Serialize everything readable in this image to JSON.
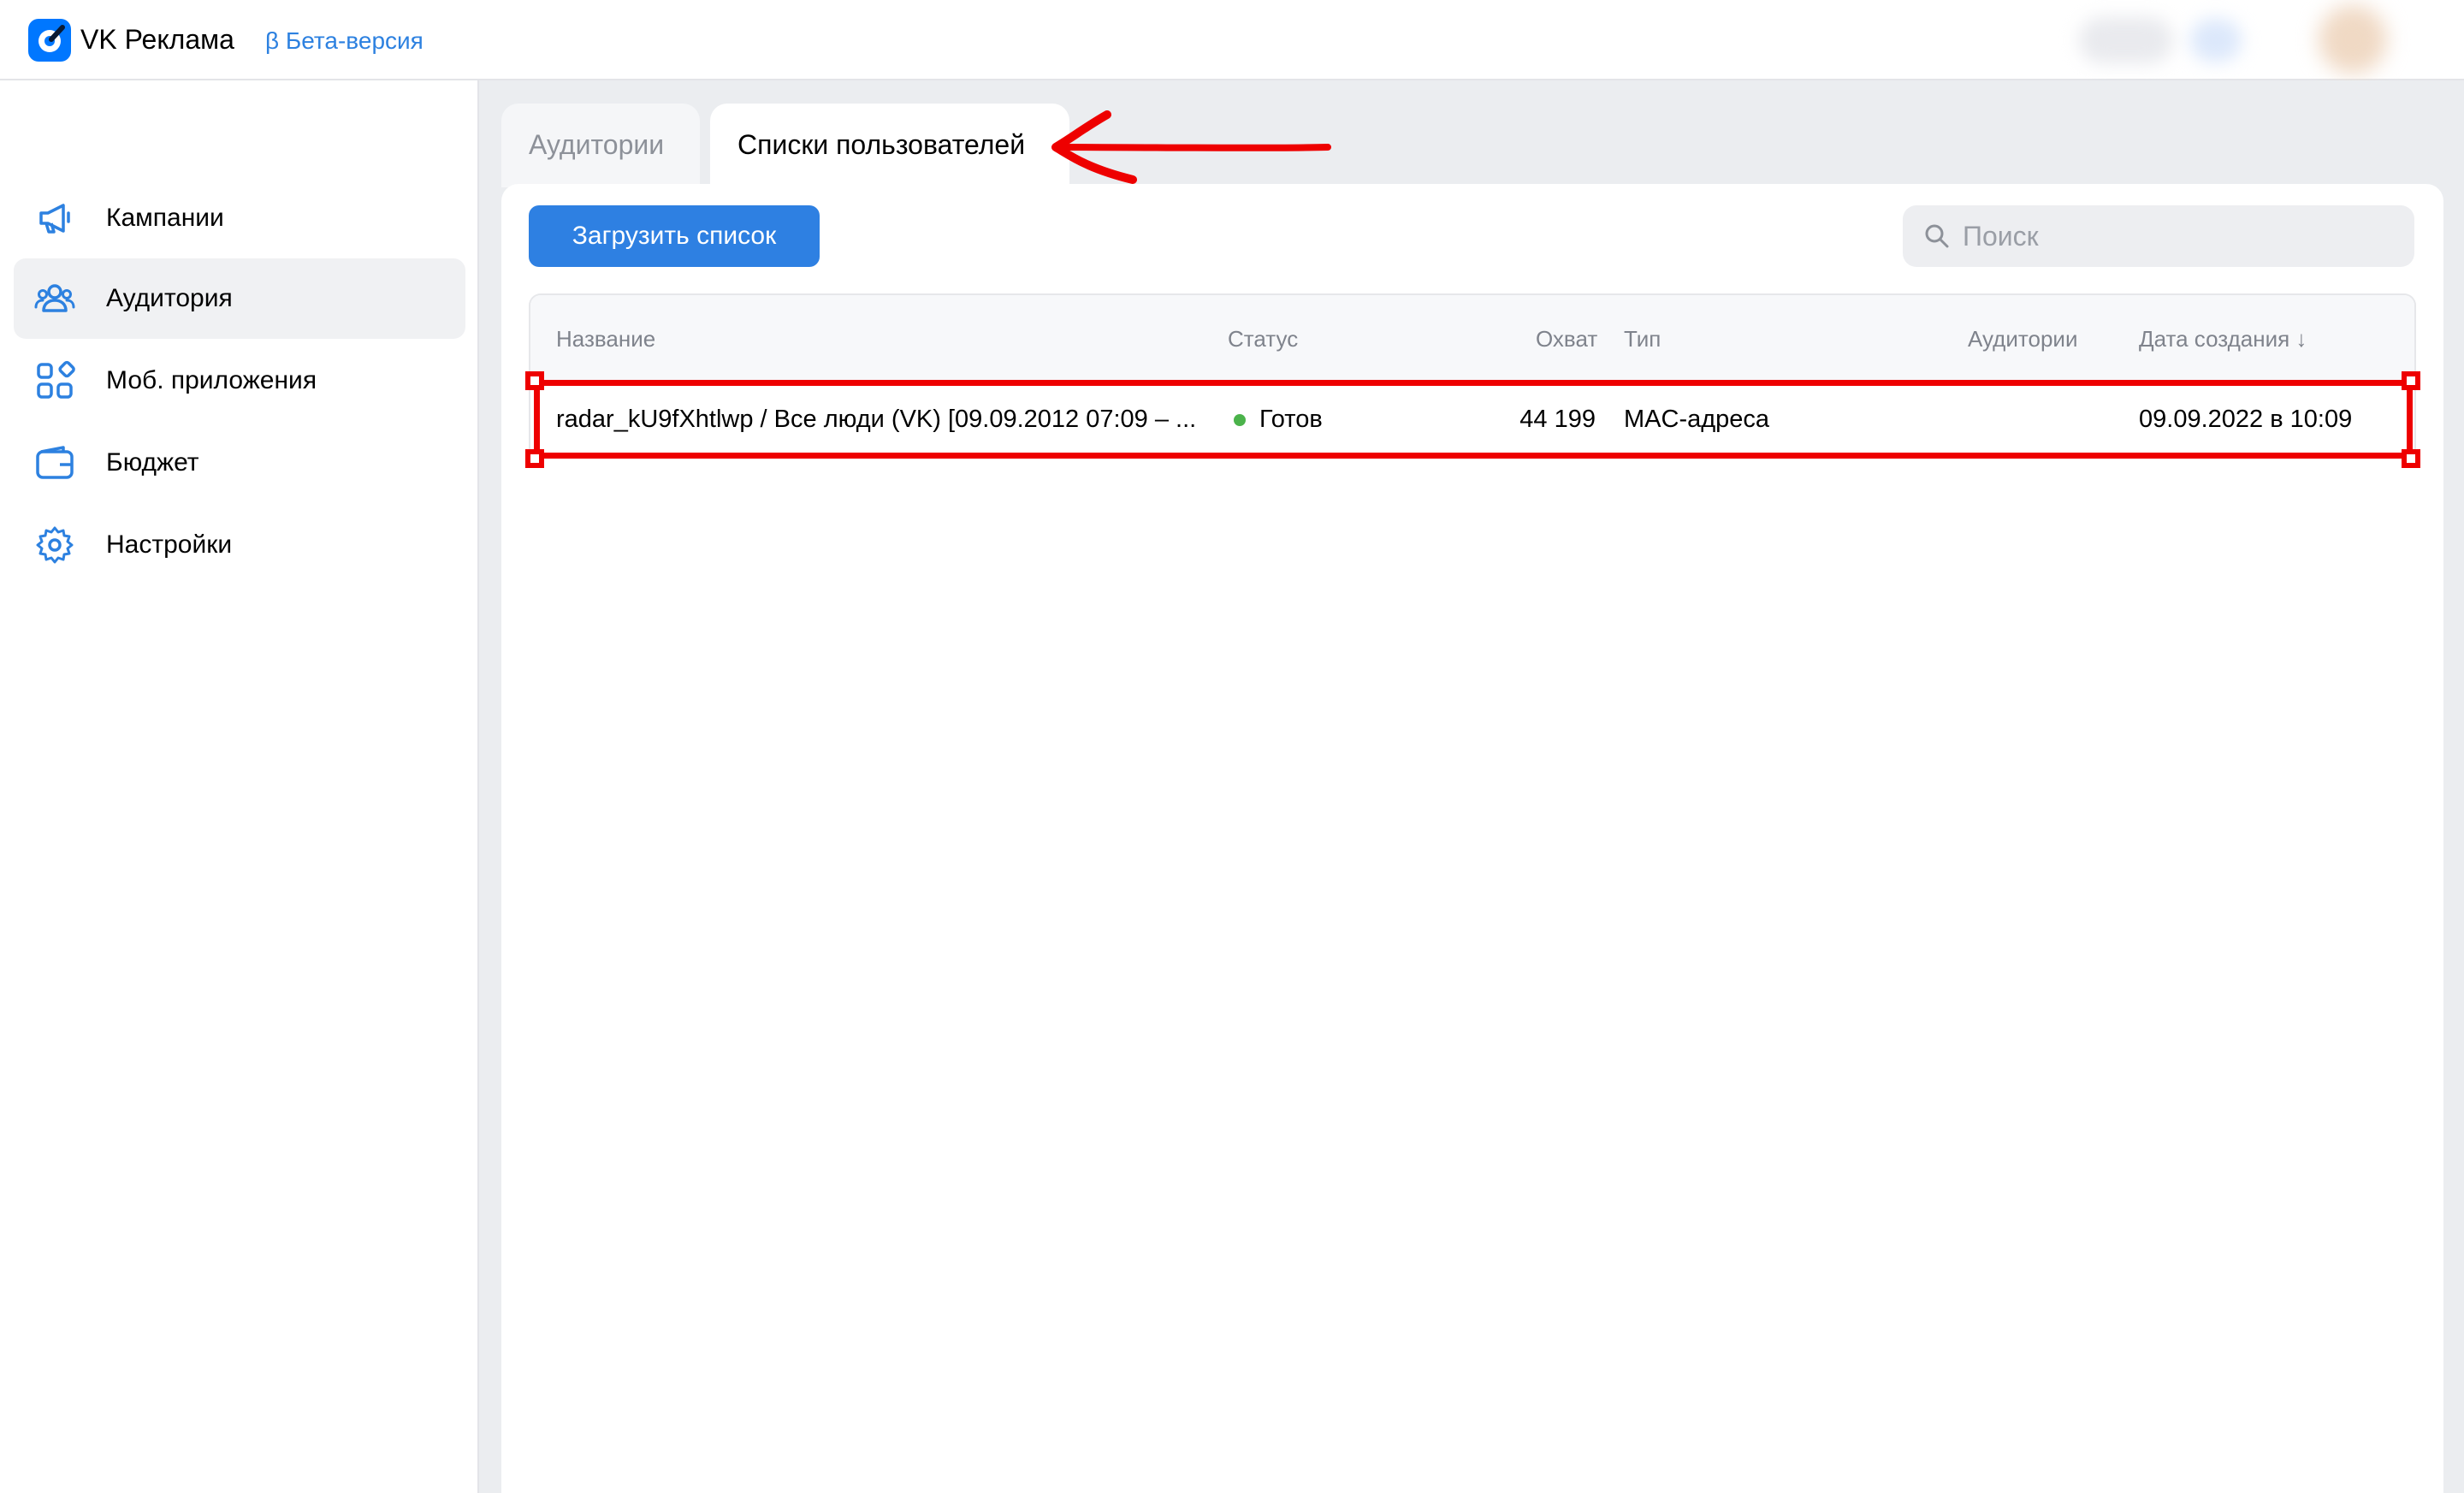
{
  "header": {
    "brand": "VK Реклама",
    "beta_label": "β Бета-версия",
    "accent_color": "#0077ff"
  },
  "sidebar": {
    "items": [
      {
        "label": "Кампании",
        "icon": "megaphone-icon",
        "active": false
      },
      {
        "label": "Аудитория",
        "icon": "users-icon",
        "active": true
      },
      {
        "label": "Моб. приложения",
        "icon": "apps-grid-icon",
        "active": false
      },
      {
        "label": "Бюджет",
        "icon": "wallet-icon",
        "active": false
      },
      {
        "label": "Настройки",
        "icon": "gear-icon",
        "active": false
      }
    ]
  },
  "tabs": [
    {
      "label": "Аудитории",
      "active": false
    },
    {
      "label": "Списки пользователей",
      "active": true
    }
  ],
  "toolbar": {
    "upload_label": "Загрузить список",
    "search_placeholder": "Поиск",
    "primary_color": "#2e80e2"
  },
  "table": {
    "columns": [
      "Название",
      "Статус",
      "Охват",
      "Тип",
      "Аудитории",
      "Дата создания ↓"
    ],
    "rows": [
      {
        "name": "radar_kU9fXhtlwp / Все люди (VK) [09.09.2012 07:09 – ...",
        "status": "Готов",
        "status_color": "#4bb34b",
        "reach": "44 199",
        "type": "MAC-адреса",
        "audiences": "",
        "created": "09.09.2022 в 10:09"
      }
    ]
  },
  "annotation": {
    "color": "#ee0000"
  }
}
